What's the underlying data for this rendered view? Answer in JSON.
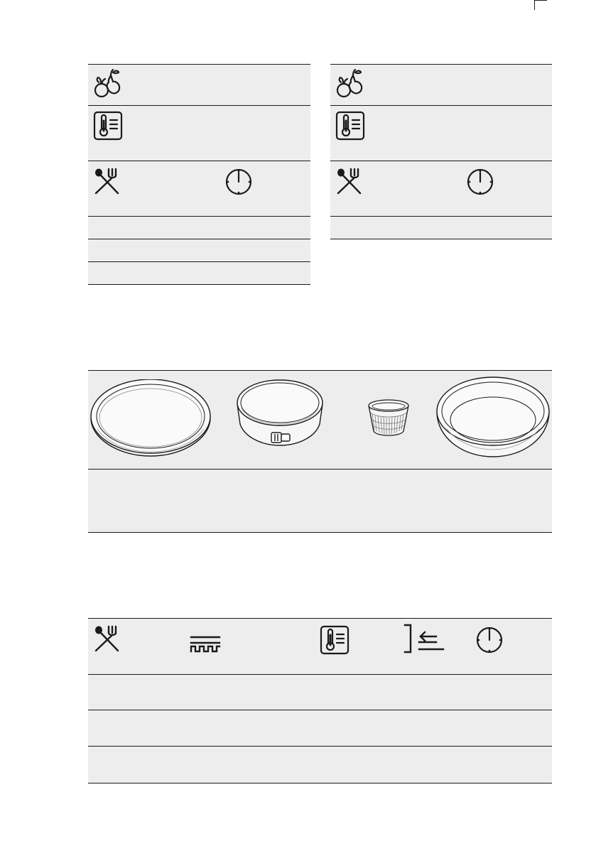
{
  "colors": {
    "row_fill": "#ededed",
    "rule": "#1a1a1a",
    "icon": "#1a1a1a"
  },
  "table1": {
    "header_icons": [
      "fruit-icon",
      "thermometer-icon",
      "cutlery-icon",
      "clock-icon"
    ],
    "rows": [
      {},
      {},
      {}
    ]
  },
  "table2": {
    "header_icons": [
      "fruit-icon",
      "thermometer-icon",
      "cutlery-icon",
      "clock-icon"
    ],
    "rows": [
      {}
    ]
  },
  "bakeware": {
    "items": [
      "shallow-round-tin",
      "springform-tin",
      "ramekin",
      "deep-round-tin"
    ]
  },
  "table3": {
    "header_icons": [
      "cutlery-icon",
      "shelf-icon",
      "thermometer-icon",
      "shelf-position-icon",
      "clock-icon"
    ],
    "rows": [
      {},
      {},
      {}
    ]
  }
}
